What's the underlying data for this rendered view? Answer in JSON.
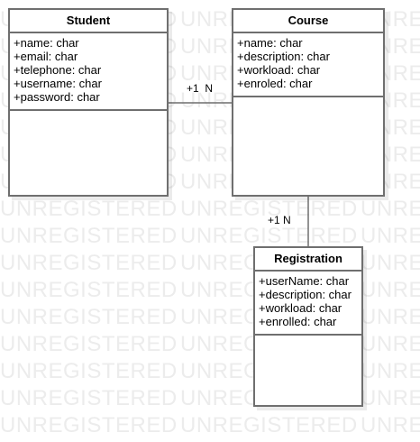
{
  "watermark_text": "UNREGISTERED",
  "classes": {
    "student": {
      "name": "Student",
      "attributes": [
        "+name: char",
        "+email: char",
        "+telephone: char",
        "+username: char",
        "+password: char"
      ]
    },
    "course": {
      "name": "Course",
      "attributes": [
        "+name: char",
        "+description: char",
        "+workload: char",
        "+enroled: char"
      ]
    },
    "registration": {
      "name": "Registration",
      "attributes": [
        "+userName: char",
        "+description: char",
        "+workload: char",
        "+enrolled: char"
      ]
    }
  },
  "associations": {
    "student_course": {
      "multiplicity": "+1  N"
    },
    "course_registration": {
      "multiplicity": "+1 N"
    }
  },
  "colors": {
    "border": "#6f6f6f",
    "watermark": "#ececec"
  }
}
